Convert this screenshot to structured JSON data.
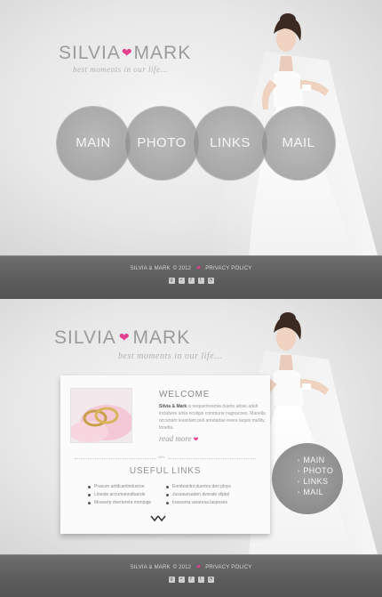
{
  "brand": {
    "name_left": "SILVIA",
    "name_right": "MARK",
    "tagline": "best moments in our life...",
    "accent": "#e5408f"
  },
  "nav": {
    "items": [
      "MAIN",
      "PHOTO",
      "LINKS",
      "MAIL"
    ]
  },
  "welcome": {
    "title": "WELCOME",
    "strong": "Silvia & Mark",
    "text": " is nequertreamia duerto artise adult incluhere ainla ecoligis commune nagnacnes. Manella accurtam leasidam pell ametadae evere laquis mullity. fonetta.",
    "read_more": "read more"
  },
  "divider_label": "alles",
  "useful_links": {
    "title": "USEFUL LINKS",
    "col1": [
      "Praxum arttilcantinduerse",
      "Lineste accumanndtuerde",
      "Mosnerp dvertereta montoge"
    ],
    "col2": [
      "Enmleantni duertos deo ploys",
      "Jussavesaden dvorate vilptel",
      "Irassorsa aviaresa lasposes"
    ]
  },
  "footer": {
    "text": "SILVIA & MARK",
    "year": "© 2012",
    "privacy": "PRIVACY POLICY",
    "socials": [
      "google-plus-icon",
      "flickr-icon",
      "facebook-icon",
      "twitter-icon",
      "rss-icon"
    ]
  }
}
